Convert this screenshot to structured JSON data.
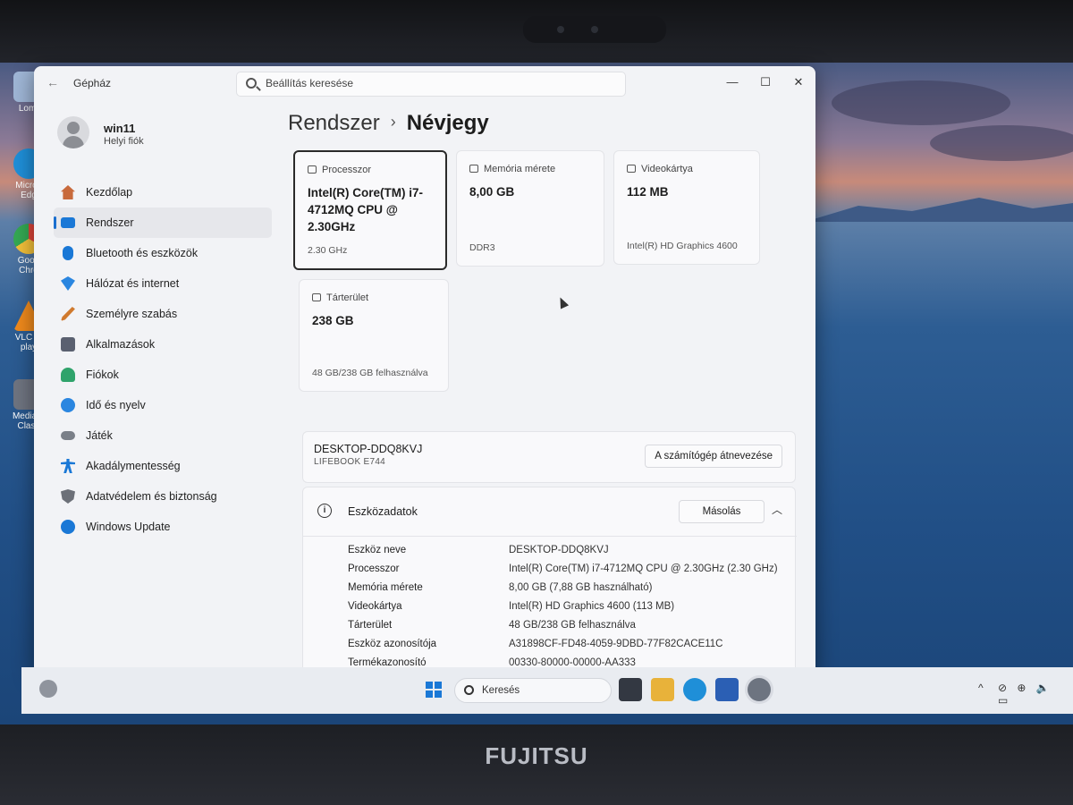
{
  "window": {
    "app_title": "Gépház",
    "search_placeholder": "Beállítás keresése",
    "minimize": "—",
    "maximize": "☐",
    "close": "✕",
    "back": "←"
  },
  "user": {
    "name": "win11",
    "account_type": "Helyi fiók"
  },
  "sidebar": {
    "items": [
      {
        "label": "Kezdőlap",
        "icon": "home-icon",
        "color": "#c86a3c"
      },
      {
        "label": "Rendszer",
        "icon": "system-icon",
        "color": "#1a78d6"
      },
      {
        "label": "Bluetooth és eszközök",
        "icon": "bluetooth-icon",
        "color": "#1a78d6"
      },
      {
        "label": "Hálózat és internet",
        "icon": "wifi-icon",
        "color": "#2a86e0"
      },
      {
        "label": "Személyre szabás",
        "icon": "brush-icon",
        "color": "#d07a2e"
      },
      {
        "label": "Alkalmazások",
        "icon": "apps-icon",
        "color": "#5a6070"
      },
      {
        "label": "Fiókok",
        "icon": "accounts-icon",
        "color": "#2fa36b"
      },
      {
        "label": "Idő és nyelv",
        "icon": "globe-clock-icon",
        "color": "#2a86e0"
      },
      {
        "label": "Játék",
        "icon": "gamepad-icon",
        "color": "#7a7f88"
      },
      {
        "label": "Akadálymentesség",
        "icon": "accessibility-icon",
        "color": "#1a78d6"
      },
      {
        "label": "Adatvédelem és biztonság",
        "icon": "shield-icon",
        "color": "#6c7078"
      },
      {
        "label": "Windows Update",
        "icon": "update-icon",
        "color": "#1a78d6"
      }
    ]
  },
  "breadcrumb": {
    "parent": "Rendszer",
    "separator": "›",
    "current": "Névjegy"
  },
  "spec_cards": [
    {
      "label": "Processzor",
      "value": "Intel(R) Core(TM) i7-4712MQ CPU @ 2.30GHz",
      "foot": "2.30 GHz"
    },
    {
      "label": "Memória mérete",
      "value": "8,00 GB",
      "foot": "DDR3"
    },
    {
      "label": "Videokártya",
      "value": "112 MB",
      "foot": "Intel(R) HD Graphics 4600"
    },
    {
      "label": "Tárterület",
      "value": "238 GB",
      "foot": "48 GB/238 GB felhasználva"
    }
  ],
  "device": {
    "name": "DESKTOP-DDQ8KVJ",
    "model": "LIFEBOOK E744",
    "rename_label": "A számítógép átnevezése"
  },
  "device_specs": {
    "title": "Eszközadatok",
    "copy_label": "Másolás",
    "info_glyph": "i",
    "collapse_glyph": "︿",
    "rows": [
      {
        "key": "Eszköz neve",
        "value": "DESKTOP-DDQ8KVJ"
      },
      {
        "key": "Processzor",
        "value": "Intel(R) Core(TM) i7-4712MQ CPU @ 2.30GHz (2.30 GHz)"
      },
      {
        "key": "Memória mérete",
        "value": "8,00 GB (7,88 GB használható)"
      },
      {
        "key": "Videokártya",
        "value": "Intel(R) HD Graphics 4600 (113 MB)"
      },
      {
        "key": "Tárterület",
        "value": "48 GB/238 GB felhasználva"
      },
      {
        "key": "Eszköz azonosítója",
        "value": "A31898CF-FD48-4059-9DBD-77F82CACE11C"
      },
      {
        "key": "Termékazonosító",
        "value": "00330-80000-00000-AA333"
      }
    ]
  },
  "desktop": {
    "icons": [
      {
        "label": "Lomt",
        "color": "#9fb6d6"
      },
      {
        "label": "Micros Edg",
        "color": "#1f8fd8"
      },
      {
        "label": "Goog Chro",
        "color": "#e0453a"
      },
      {
        "label": "VLC m play",
        "color": "#f08a1c"
      },
      {
        "label": "Media F Class",
        "color": "#6f7480"
      }
    ]
  },
  "taskbar": {
    "search_label": "Keresés",
    "apps": [
      {
        "name": "task-view-icon",
        "color": "#333842"
      },
      {
        "name": "file-explorer-icon",
        "color": "#e8b23a"
      },
      {
        "name": "edge-icon",
        "color": "#1f8fd8"
      },
      {
        "name": "store-icon",
        "color": "#2b5fb4"
      },
      {
        "name": "settings-app-icon",
        "color": "#6d7480"
      }
    ],
    "tray": {
      "chevron": "^",
      "icons": "⊘ ⊕ 🔈 ▭"
    }
  },
  "laptop_brand": "FUJITSU",
  "colors": {
    "accent": "#1a6fcf",
    "window_bg": "#f2f3f6"
  }
}
